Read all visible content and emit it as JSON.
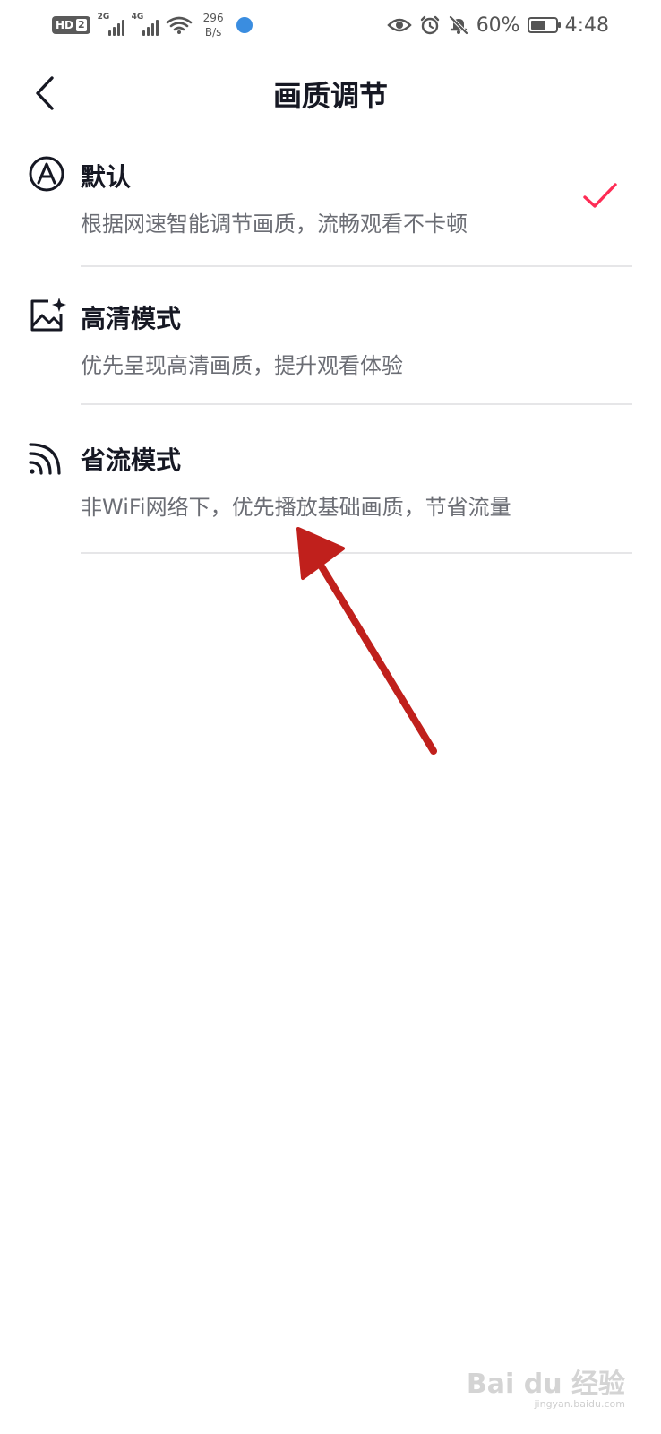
{
  "status_bar": {
    "hd_label": "HD",
    "sim_label": "2",
    "network_1": "2G",
    "network_2": "4G",
    "speed_value": "296",
    "speed_unit": "B/s",
    "battery_percent": "60%",
    "battery_level": 0.6,
    "time": "4:48",
    "icons_right": [
      "eye-icon",
      "alarm-icon",
      "bell-off-icon"
    ]
  },
  "header": {
    "back_icon": "chevron-left-icon",
    "title": "画质调节"
  },
  "options": [
    {
      "icon": "auto-a-icon",
      "title": "默认",
      "description": "根据网速智能调节画质，流畅观看不卡顿",
      "selected": true
    },
    {
      "icon": "image-sparkle-icon",
      "title": "高清模式",
      "description": "优先呈现高清画质，提升观看体验",
      "selected": false
    },
    {
      "icon": "signal-waves-icon",
      "title": "省流模式",
      "description": "非WiFi网络下，优先播放基础画质，节省流量",
      "selected": false
    }
  ],
  "colors": {
    "accent_check": "#fe2c55",
    "annotation_arrow": "#c0201c",
    "text_primary": "#161823",
    "text_secondary": "#6b6d74"
  },
  "watermark": {
    "brand": "Bai du 经验",
    "url": "jingyan.baidu.com"
  }
}
